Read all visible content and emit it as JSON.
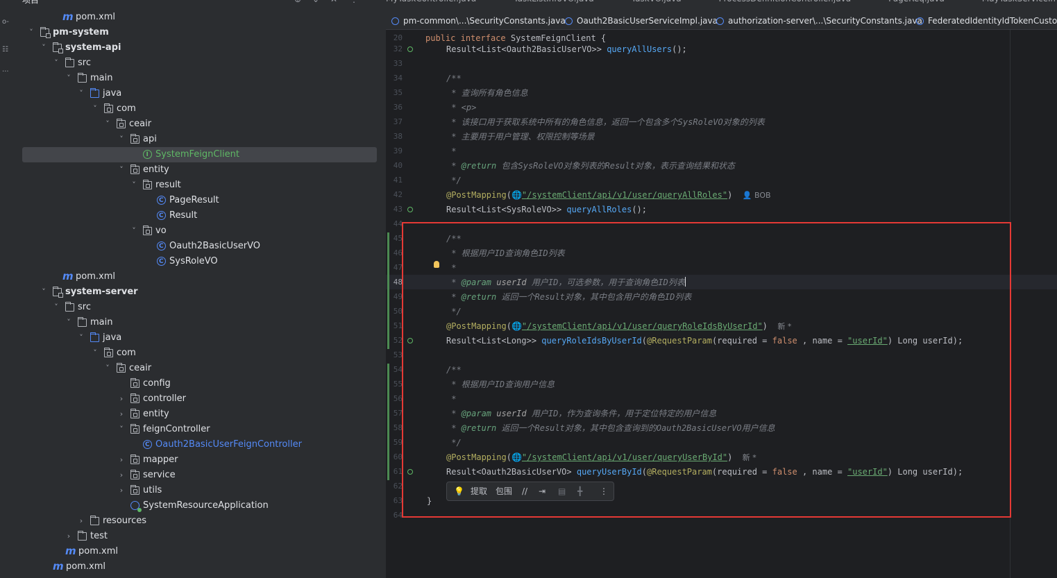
{
  "project": {
    "title": "项目",
    "tree": [
      {
        "label": "pom.xml",
        "icon": "maven-file-icon"
      },
      {
        "label": "pm-system",
        "icon": "module-folder-icon",
        "arrow": "expanded"
      },
      {
        "label": "system-api",
        "icon": "module-folder-icon",
        "arrow": "expanded"
      },
      {
        "label": "src",
        "icon": "folder-icon",
        "arrow": "expanded"
      },
      {
        "label": "main",
        "icon": "folder-icon",
        "arrow": "expanded"
      },
      {
        "label": "java",
        "icon": "source-folder-icon",
        "arrow": "expanded"
      },
      {
        "label": "com",
        "icon": "package-icon",
        "arrow": "expanded"
      },
      {
        "label": "ceair",
        "icon": "package-icon",
        "arrow": "expanded"
      },
      {
        "label": "api",
        "icon": "package-icon",
        "arrow": "expanded"
      },
      {
        "label": "SystemFeignClient",
        "icon": "interface-icon",
        "selected": true
      },
      {
        "label": "entity",
        "icon": "package-icon",
        "arrow": "expanded"
      },
      {
        "label": "result",
        "icon": "package-icon",
        "arrow": "expanded"
      },
      {
        "label": "PageResult",
        "icon": "class-icon"
      },
      {
        "label": "Result",
        "icon": "class-icon"
      },
      {
        "label": "vo",
        "icon": "package-icon",
        "arrow": "expanded"
      },
      {
        "label": "Oauth2BasicUserVO",
        "icon": "class-icon"
      },
      {
        "label": "SysRoleVO",
        "icon": "class-icon"
      },
      {
        "label": "pom.xml",
        "icon": "maven-file-icon"
      },
      {
        "label": "system-server",
        "icon": "module-folder-icon",
        "arrow": "expanded"
      },
      {
        "label": "src",
        "icon": "folder-icon",
        "arrow": "expanded"
      },
      {
        "label": "main",
        "icon": "folder-icon",
        "arrow": "expanded"
      },
      {
        "label": "java",
        "icon": "source-folder-icon",
        "arrow": "expanded"
      },
      {
        "label": "com",
        "icon": "package-icon",
        "arrow": "expanded"
      },
      {
        "label": "ceair",
        "icon": "package-icon",
        "arrow": "expanded"
      },
      {
        "label": "config",
        "icon": "package-icon"
      },
      {
        "label": "controller",
        "icon": "package-icon",
        "arrow": "collapsed"
      },
      {
        "label": "entity",
        "icon": "package-icon",
        "arrow": "collapsed"
      },
      {
        "label": "feignController",
        "icon": "package-icon",
        "arrow": "expanded"
      },
      {
        "label": "Oauth2BasicUserFeignController",
        "icon": "class-icon"
      },
      {
        "label": "mapper",
        "icon": "package-icon",
        "arrow": "collapsed"
      },
      {
        "label": "service",
        "icon": "package-icon",
        "arrow": "collapsed"
      },
      {
        "label": "utils",
        "icon": "package-icon",
        "arrow": "collapsed"
      },
      {
        "label": "SystemResourceApplication",
        "icon": "spring-app-icon"
      },
      {
        "label": "resources",
        "icon": "resources-folder-icon",
        "arrow": "collapsed"
      },
      {
        "label": "test",
        "icon": "folder-icon",
        "arrow": "collapsed"
      },
      {
        "label": "pom.xml",
        "icon": "maven-file-icon"
      },
      {
        "label": "pom.xml",
        "icon": "maven-file-icon"
      }
    ]
  },
  "tabs": {
    "top_row": [
      "MyTaskController.java",
      "TaskListInfoVO.java",
      "TaskVO.java",
      "ProcessDefinitionController.java",
      "PageReq.java",
      "MayTaskServiceImpl.java",
      "IMay"
    ],
    "row": [
      "pm-common\\...\\SecurityConstants.java",
      "Oauth2BasicUserServiceImpl.java",
      "authorization-server\\...\\SecurityConstants.java",
      "FederatedIdentityIdTokenCustomize"
    ]
  },
  "editor": {
    "line_numbers": [
      "20",
      "32",
      "33",
      "34",
      "35",
      "36",
      "37",
      "38",
      "39",
      "40",
      "41",
      "42",
      "43",
      "44",
      "45",
      "46",
      "47",
      "48",
      "49",
      "50",
      "51",
      "52",
      "53",
      "54",
      "55",
      "56",
      "57",
      "58",
      "59",
      "60",
      "61",
      "62",
      "63",
      "64"
    ],
    "current_line": "48",
    "l20": {
      "kw1": "public",
      "kw2": "interface",
      "name": "SystemFeignClient",
      "brace": " {"
    },
    "l32": {
      "type": "Result<List<Oauth2BasicUserVO>> ",
      "fn": "queryAllUsers",
      "tail": "();"
    },
    "l34": "/**",
    "l35": " * 查询所有角色信息",
    "l36": " * <p>",
    "l37": " * 该接口用于获取系统中所有的角色信息，返回一个包含多个SysRoleVO对象的列表",
    "l38": " * 主要用于用户管理、权限控制等场景",
    "l39": " *",
    "l40": {
      "star": " * ",
      "tag": "@return",
      "text": " 包含SysRoleVO对象列表的Result对象，表示查询结果和状态"
    },
    "l41": " */",
    "l42": {
      "ann": "@PostMapping",
      "open": "(",
      "str": "\"/systemClient/api/v1/user/queryAllRoles\"",
      "close": ")",
      "hint": "BOB"
    },
    "l43": {
      "type": "Result<List<SysRoleVO>> ",
      "fn": "queryAllRoles",
      "tail": "();"
    },
    "l45": "/**",
    "l46": " * 根据用户ID查询角色ID列表",
    "l47": " *",
    "l48": {
      "star": " * ",
      "tag": "@param",
      "name": " userId",
      "text": " 用户ID，可选参数，用于查询角色ID列表"
    },
    "l49": {
      "star": " * ",
      "tag": "@return",
      "text": " 返回一个Result对象，其中包含用户的角色ID列表"
    },
    "l50": " */",
    "l51": {
      "ann": "@PostMapping",
      "open": "(",
      "str": "\"/systemClient/api/v1/user/queryRoleIdsByUserId\"",
      "close": ")",
      "hint": "新 *"
    },
    "l52": {
      "type": "Result<List<Long>> ",
      "fn": "queryRoleIdsByUserId",
      "p1": "(",
      "ann": "@RequestParam",
      "p2": "(required = ",
      "kw": "false",
      "p3": " , name = ",
      "str": "\"userId\"",
      "p4": ") Long userId);"
    },
    "l54": "/**",
    "l55": " * 根据用户ID查询用户信息",
    "l56": " *",
    "l57": {
      "star": " * ",
      "tag": "@param",
      "name": " userId",
      "text": " 用户ID，作为查询条件，用于定位特定的用户信息"
    },
    "l58": {
      "star": " * ",
      "tag": "@return",
      "text": " 返回一个Result对象，其中包含查询到的Oauth2BasicUserVO用户信息"
    },
    "l59": " */",
    "l60": {
      "ann": "@PostMapping",
      "open": "(",
      "str": "\"/systemClient/api/v1/user/queryUserById\"",
      "close": ")",
      "hint": "新 *"
    },
    "l61": {
      "type": "Result<Oauth2BasicUserVO> ",
      "fn": "queryUserById",
      "p1": "(",
      "ann": "@RequestParam",
      "p2": "(required = ",
      "kw": "false",
      "p3": " , name = ",
      "str": "\"userId\"",
      "p4": ") Long userId);"
    },
    "l63": "}"
  },
  "inline_toolbar": {
    "extract": "提取",
    "surround": "包围",
    "comment": "//",
    "format": "⇥",
    "more": "⋮"
  },
  "colors": {
    "highlight_box": "#e53935",
    "accent": "#548af7",
    "keyword": "#cf8e6d",
    "string": "#6aab73",
    "function": "#56a8f5",
    "annotation": "#b3ae60",
    "comment": "#7a7e85"
  }
}
